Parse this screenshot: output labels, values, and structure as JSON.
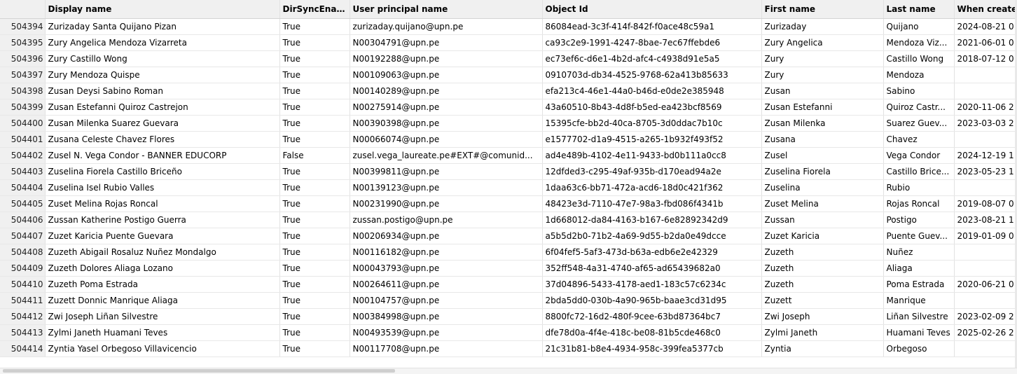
{
  "columns": [
    "",
    "Display name",
    "DirSyncEnab...",
    "User principal name",
    "Object Id",
    "First name",
    "Last name",
    "When create"
  ],
  "rows": [
    {
      "id": "504394",
      "display": "Zurizaday Santa Quijano Pizan",
      "dirsync": "True",
      "upn": "zurizaday.quijano@upn.pe",
      "oid": "86084ead-3c3f-414f-842f-f0ace48c59a1",
      "first": "Zurizaday",
      "last": "Quijano",
      "when": "2024-08-21 0"
    },
    {
      "id": "504395",
      "display": "Zury Angelica Mendoza Vizarreta",
      "dirsync": "True",
      "upn": "N00304791@upn.pe",
      "oid": "ca93c2e9-1991-4247-8bae-7ec67ffebde6",
      "first": "Zury Angelica",
      "last": "Mendoza Viz...",
      "when": "2021-06-01 0"
    },
    {
      "id": "504396",
      "display": "Zury Castillo Wong",
      "dirsync": "True",
      "upn": "N00192288@upn.pe",
      "oid": "ec73ef6c-d6e1-4b2d-afc4-c4938d91e5a5",
      "first": "Zury",
      "last": "Castillo Wong",
      "when": "2018-07-12 0"
    },
    {
      "id": "504397",
      "display": "Zury Mendoza Quispe",
      "dirsync": "True",
      "upn": "N00109063@upn.pe",
      "oid": "0910703d-db34-4525-9768-62a413b85633",
      "first": "Zury",
      "last": "Mendoza",
      "when": ""
    },
    {
      "id": "504398",
      "display": "Zusan Deysi Sabino Roman",
      "dirsync": "True",
      "upn": "N00140289@upn.pe",
      "oid": "efa213c4-46e1-44a0-b46d-e0de2e385948",
      "first": "Zusan",
      "last": "Sabino",
      "when": ""
    },
    {
      "id": "504399",
      "display": "Zusan Estefanni Quiroz Castrejon",
      "dirsync": "True",
      "upn": "N00275914@upn.pe",
      "oid": "43a60510-8b43-4d8f-b5ed-ea423bcf8569",
      "first": "Zusan Estefanni",
      "last": "Quiroz Castr...",
      "when": "2020-11-06 2"
    },
    {
      "id": "504400",
      "display": "Zusan Milenka Suarez Guevara",
      "dirsync": "True",
      "upn": "N00390398@upn.pe",
      "oid": "15395cfe-bb2d-40ca-8705-3d0ddac7b10c",
      "first": "Zusan Milenka",
      "last": "Suarez Guev...",
      "when": "2023-03-03 2"
    },
    {
      "id": "504401",
      "display": "Zusana Celeste Chavez Flores",
      "dirsync": "True",
      "upn": "N00066074@upn.pe",
      "oid": "e1577702-d1a9-4515-a265-1b932f493f52",
      "first": "Zusana",
      "last": "Chavez",
      "when": ""
    },
    {
      "id": "504402",
      "display": "Zusel N. Vega Condor - BANNER EDUCORP",
      "dirsync": "False",
      "upn": "zusel.vega_laureate.pe#EXT#@comunid...",
      "oid": "ad4e489b-4102-4e11-9433-bd0b111a0cc8",
      "first": "Zusel",
      "last": "Vega Condor",
      "when": "2024-12-19 1"
    },
    {
      "id": "504403",
      "display": "Zuselina Fiorela Castillo Briceño",
      "dirsync": "True",
      "upn": "N00399811@upn.pe",
      "oid": "12dfded3-c295-49af-935b-d170ead94a2e",
      "first": "Zuselina Fiorela",
      "last": "Castillo Brice...",
      "when": "2023-05-23 1"
    },
    {
      "id": "504404",
      "display": "Zuselina Isel Rubio Valles",
      "dirsync": "True",
      "upn": "N00139123@upn.pe",
      "oid": "1daa63c6-bb71-472a-acd6-18d0c421f362",
      "first": "Zuselina",
      "last": "Rubio",
      "when": ""
    },
    {
      "id": "504405",
      "display": "Zuset Melina Rojas Roncal",
      "dirsync": "True",
      "upn": "N00231990@upn.pe",
      "oid": "48423e3d-7110-47e7-98a3-fbd086f4341b",
      "first": "Zuset Melina",
      "last": "Rojas Roncal",
      "when": "2019-08-07 0"
    },
    {
      "id": "504406",
      "display": "Zussan Katherine Postigo Guerra",
      "dirsync": "True",
      "upn": "zussan.postigo@upn.pe",
      "oid": "1d668012-da84-4163-b167-6e82892342d9",
      "first": "Zussan",
      "last": "Postigo",
      "when": "2023-08-21 1"
    },
    {
      "id": "504407",
      "display": "Zuzet Karicia Puente Guevara",
      "dirsync": "True",
      "upn": "N00206934@upn.pe",
      "oid": "a5b5d2b0-71b2-4a69-9d55-b2da0e49dcce",
      "first": "Zuzet Karicia",
      "last": "Puente Guev...",
      "when": "2019-01-09 0"
    },
    {
      "id": "504408",
      "display": "Zuzeth Abigail Rosaluz Nuñez Mondalgo",
      "dirsync": "True",
      "upn": "N00116182@upn.pe",
      "oid": "6f04fef5-5af3-473d-b63a-edb6e2e42329",
      "first": "Zuzeth",
      "last": "Nuñez",
      "when": ""
    },
    {
      "id": "504409",
      "display": "Zuzeth Dolores Aliaga Lozano",
      "dirsync": "True",
      "upn": "N00043793@upn.pe",
      "oid": "352ff548-4a31-4740-af65-ad65439682a0",
      "first": "Zuzeth",
      "last": "Aliaga",
      "when": ""
    },
    {
      "id": "504410",
      "display": "Zuzeth Poma Estrada",
      "dirsync": "True",
      "upn": "N00264611@upn.pe",
      "oid": "37d04896-5433-4178-aed1-183c57c6234c",
      "first": "Zuzeth",
      "last": "Poma Estrada",
      "when": "2020-06-21 0"
    },
    {
      "id": "504411",
      "display": "Zuzett Donnic Manrique Aliaga",
      "dirsync": "True",
      "upn": "N00104757@upn.pe",
      "oid": "2bda5dd0-030b-4a90-965b-baae3cd31d95",
      "first": "Zuzett",
      "last": "Manrique",
      "when": ""
    },
    {
      "id": "504412",
      "display": "Zwi Joseph Liñan Silvestre",
      "dirsync": "True",
      "upn": "N00384998@upn.pe",
      "oid": "8800fc72-16d2-480f-9cee-63bd87364bc7",
      "first": "Zwi Joseph",
      "last": "Liñan Silvestre",
      "when": "2023-02-09 2"
    },
    {
      "id": "504413",
      "display": "Zylmi Janeth Huamani Teves",
      "dirsync": "True",
      "upn": "N00493539@upn.pe",
      "oid": "dfe78d0a-4f4e-418c-be08-81b5cde468c0",
      "first": "Zylmi Janeth",
      "last": "Huamani Teves",
      "when": "2025-02-26 2"
    },
    {
      "id": "504414",
      "display": "Zyntia Yasel Orbegoso Villavicencio",
      "dirsync": "True",
      "upn": "N00117708@upn.pe",
      "oid": "21c31b81-b8e4-4934-958c-399fea5377cb",
      "first": "Zyntia",
      "last": "Orbegoso",
      "when": ""
    }
  ]
}
